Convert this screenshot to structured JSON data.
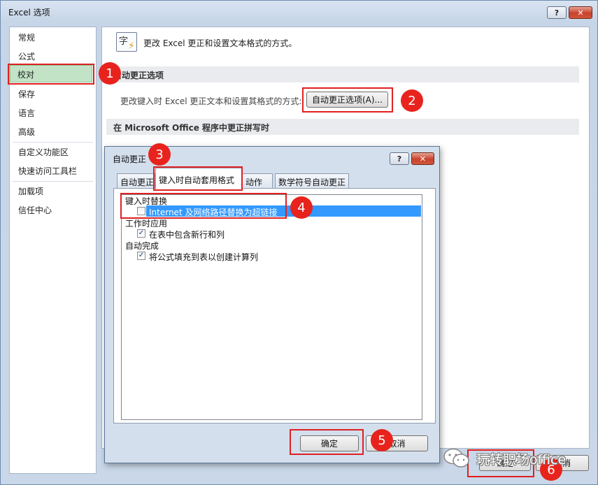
{
  "outer": {
    "title": "Excel 选项",
    "help_label": "?",
    "close_label": "✕",
    "nav": [
      "常规",
      "公式",
      "校对",
      "保存",
      "语言",
      "高级",
      "自定义功能区",
      "快速访问工具栏",
      "加载项",
      "信任中心"
    ],
    "header_desc": "更改 Excel 更正和设置文本格式的方式。",
    "abc_icon_glyph": "字A",
    "section1": "自动更正选项",
    "change_desc": "更改键入时 Excel 更正文本和设置其格式的方式:",
    "autocorrect_button": "自动更正选项(A)...",
    "section2": "在 Microsoft Office 程序中更正拼写时",
    "ok_label": "确定",
    "cancel_label": "取消"
  },
  "dialog": {
    "title": "自动更正",
    "help_label": "?",
    "close_label": "✕",
    "tabs": [
      "自动更正",
      "键入时自动套用格式",
      "动作",
      "数学符号自动更正"
    ],
    "groups": [
      "键入时替换",
      "工作时应用",
      "自动完成"
    ],
    "options": [
      {
        "label": "Internet 及网络路径替换为超链接",
        "checked": false
      },
      {
        "label": "在表中包含新行和列",
        "checked": true
      },
      {
        "label": "将公式填充到表以创建计算列",
        "checked": true
      }
    ],
    "ok_label": "确定",
    "cancel_label": "取消"
  },
  "annotations": [
    "1",
    "2",
    "3",
    "4",
    "5",
    "6"
  ],
  "watermark": "玩转职场office",
  "colors": {
    "annotation_red": "#e02020",
    "nav_selected": "#c3e3c7",
    "list_highlight": "#3399ff"
  }
}
